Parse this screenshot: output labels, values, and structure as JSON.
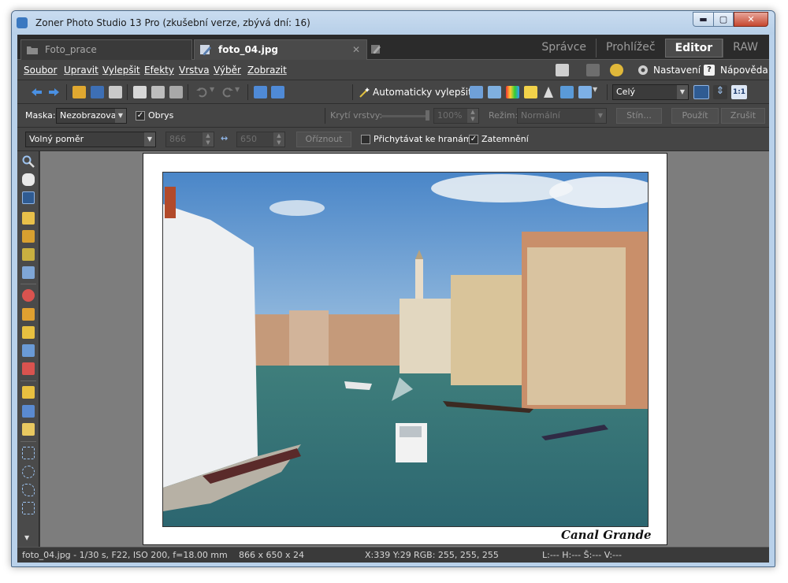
{
  "window": {
    "title": "Zoner Photo Studio 13 Pro (zkušební verze, zbývá dní: 16)",
    "min_label": "▬",
    "max_label": "▢",
    "close_label": "✕"
  },
  "tabs": [
    {
      "label": "Foto_prace"
    },
    {
      "label": "foto_04.jpg",
      "close": "✕"
    }
  ],
  "modes": [
    "Správce",
    "Prohlížeč",
    "Editor",
    "RAW"
  ],
  "menu": {
    "items": [
      "Soubor",
      "Upravit",
      "Vylepšit",
      "Efekty",
      "Vrstva",
      "Výběr",
      "Zobrazit"
    ],
    "settings": "Nastavení",
    "help": "Nápověda"
  },
  "toolbar": {
    "auto_enhance": "Automaticky vylepšit",
    "view_select": "Celý",
    "one_to_one": "1:1"
  },
  "options": {
    "mask_label": "Maska:",
    "mask_value": "Nezobrazovat",
    "outline_label": "Obrys",
    "outline_checked": "✓",
    "layer_opacity_label": "Krytí vrstvy:",
    "layer_opacity_value": "100%",
    "mode_label": "Režim:",
    "mode_value": "Normální",
    "shadow_btn": "Stín...",
    "apply_btn": "Použít",
    "cancel_btn": "Zrušit"
  },
  "crop": {
    "ratio_value": "Volný poměr",
    "width": "866",
    "height": "650",
    "crop_btn": "Oříznout",
    "snap_label": "Přichytávat ke hranám",
    "snap_checked": "",
    "darken_label": "Zatemnění",
    "darken_checked": "✓",
    "swap_icon": "↔"
  },
  "document": {
    "caption": "Canal Grande"
  },
  "status": {
    "file_info": "foto_04.jpg - 1/30 s, F22, ISO 200, f=18.00 mm",
    "dimensions": "866 x 650 x 24",
    "cursor": "X:339 Y:29",
    "rgb": "RGB: 255, 255, 255",
    "lhsv": "L:---  H:---  Š:---  V:---"
  },
  "colors": {
    "accent": "#3a78c0",
    "ui_dark": "#3a3a3a",
    "canvas_bg": "#7d7d7d"
  }
}
